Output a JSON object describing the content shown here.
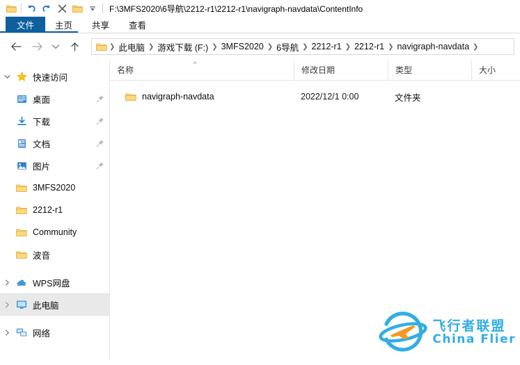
{
  "window": {
    "title_path": "F:\\3MFS2020\\6导航\\2212-r1\\2212-r1\\navigraph-navdata\\ContentInfo"
  },
  "quick_access_toolbar": {
    "buttons": [
      {
        "name": "explorer-icon",
        "label": ""
      },
      {
        "name": "undo-icon",
        "label": ""
      },
      {
        "name": "redo-icon",
        "label": ""
      },
      {
        "name": "delete-icon",
        "label": ""
      },
      {
        "name": "new-folder-icon",
        "label": ""
      },
      {
        "name": "customize-dropdown-icon",
        "label": ""
      }
    ]
  },
  "ribbon": {
    "tabs": [
      {
        "label": "文件",
        "active": true
      },
      {
        "label": "主页",
        "active": false
      },
      {
        "label": "共享",
        "active": false
      },
      {
        "label": "查看",
        "active": false
      }
    ],
    "accent_color": "#0d5f9e"
  },
  "navigation": {
    "back_tooltip": "后退",
    "forward_tooltip": "前进",
    "recent_tooltip": "最近浏览的位置",
    "up_tooltip": "上移到上一级",
    "breadcrumbs": [
      "此电脑",
      "游戏下载 (F:)",
      "3MFS2020",
      "6导航",
      "2212-r1",
      "2212-r1",
      "navigraph-navdata"
    ]
  },
  "sidebar": {
    "sections": [
      {
        "name": "quick-access",
        "label": "快速访问",
        "icon": "star-icon",
        "expanded": true,
        "items": [
          {
            "label": "桌面",
            "icon": "desktop-icon",
            "pinned": true
          },
          {
            "label": "下载",
            "icon": "downloads-icon",
            "pinned": true
          },
          {
            "label": "文档",
            "icon": "documents-icon",
            "pinned": true
          },
          {
            "label": "图片",
            "icon": "pictures-icon",
            "pinned": true
          },
          {
            "label": "3MFS2020",
            "icon": "folder-icon",
            "pinned": false
          },
          {
            "label": "2212-r1",
            "icon": "folder-icon",
            "pinned": false
          },
          {
            "label": "Community",
            "icon": "folder-icon",
            "pinned": false
          },
          {
            "label": "波音",
            "icon": "folder-icon",
            "pinned": false
          }
        ]
      },
      {
        "name": "wps-cloud",
        "label": "WPS网盘",
        "icon": "cloud-icon",
        "expanded": false,
        "items": []
      },
      {
        "name": "this-pc",
        "label": "此电脑",
        "icon": "computer-icon",
        "expanded": false,
        "selected": true,
        "items": []
      },
      {
        "name": "network",
        "label": "网络",
        "icon": "network-icon",
        "expanded": false,
        "items": []
      }
    ]
  },
  "file_list": {
    "columns": [
      {
        "label": "名称",
        "sorted": "asc"
      },
      {
        "label": "修改日期",
        "sorted": ""
      },
      {
        "label": "类型",
        "sorted": ""
      },
      {
        "label": "大小",
        "sorted": ""
      }
    ],
    "rows": [
      {
        "name": "navigraph-navdata",
        "date": "2022/12/1 0:00",
        "type": "文件夹",
        "size": "",
        "icon": "folder-icon"
      }
    ]
  },
  "watermark": {
    "cn_text": "飞行者联盟",
    "en_text": "China Flier",
    "brand_color": "#29abe2",
    "accent_color": "#f7941e",
    "icon": "plane-orbit-logo"
  }
}
